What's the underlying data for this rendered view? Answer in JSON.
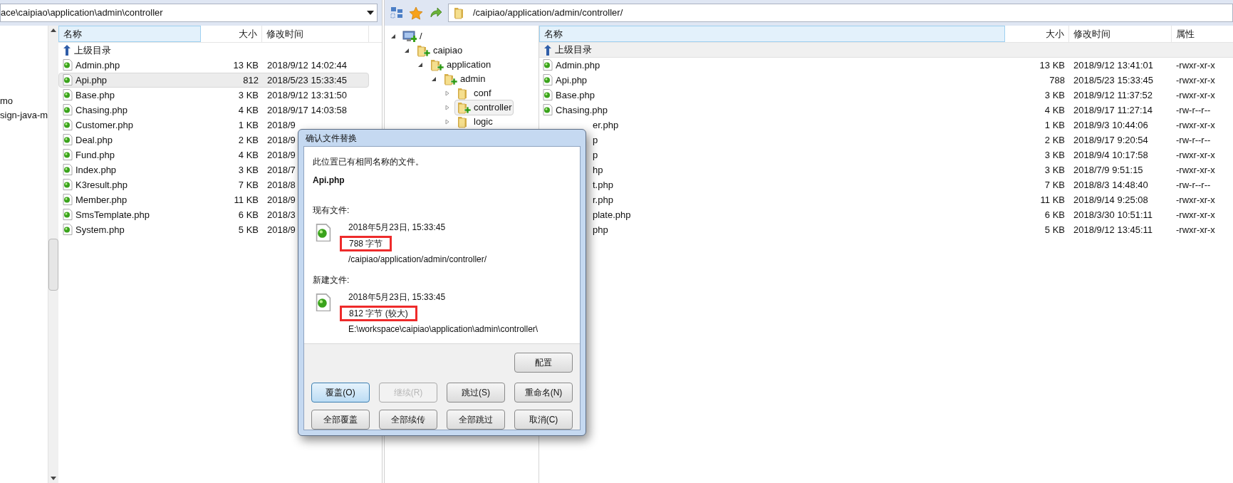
{
  "local_panel": {
    "path": "ace\\caipiao\\application\\admin\\controller",
    "tree_items": [
      {
        "label": "mo"
      },
      {
        "label": "sign-java-m"
      }
    ],
    "columns": [
      "名称",
      "大小",
      "修改时间"
    ],
    "parent_row": "上级目录",
    "files": [
      {
        "name": "Admin.php",
        "size": "13 KB",
        "modified": "2018/9/12 14:02:44",
        "selected": false
      },
      {
        "name": "Api.php",
        "size": "812",
        "modified": "2018/5/23 15:33:45",
        "selected": true
      },
      {
        "name": "Base.php",
        "size": "3 KB",
        "modified": "2018/9/12 13:31:50",
        "selected": false
      },
      {
        "name": "Chasing.php",
        "size": "4 KB",
        "modified": "2018/9/17 14:03:58",
        "selected": false
      },
      {
        "name": "Customer.php",
        "size": "1 KB",
        "modified": "2018/9",
        "selected": false
      },
      {
        "name": "Deal.php",
        "size": "2 KB",
        "modified": "2018/9",
        "selected": false
      },
      {
        "name": "Fund.php",
        "size": "4 KB",
        "modified": "2018/9",
        "selected": false
      },
      {
        "name": "Index.php",
        "size": "3 KB",
        "modified": "2018/7",
        "selected": false
      },
      {
        "name": "K3result.php",
        "size": "7 KB",
        "modified": "2018/8",
        "selected": false
      },
      {
        "name": "Member.php",
        "size": "11 KB",
        "modified": "2018/9",
        "selected": false
      },
      {
        "name": "SmsTemplate.php",
        "size": "6 KB",
        "modified": "2018/3",
        "selected": false
      },
      {
        "name": "System.php",
        "size": "5 KB",
        "modified": "2018/9",
        "selected": false
      }
    ]
  },
  "remote_panel": {
    "path": "/caipiao/application/admin/controller/",
    "tree": [
      {
        "label": "/",
        "kind": "computer",
        "expanded": true,
        "selected": false,
        "children": [
          {
            "label": "caipiao",
            "kind": "folder-plus",
            "expanded": true,
            "selected": false,
            "children": [
              {
                "label": "application",
                "kind": "folder-plus",
                "expanded": true,
                "selected": false,
                "children": [
                  {
                    "label": "admin",
                    "kind": "folder-plus",
                    "expanded": true,
                    "selected": false,
                    "children": [
                      {
                        "label": "conf",
                        "kind": "folder",
                        "expanded": false,
                        "selected": false
                      },
                      {
                        "label": "controller",
                        "kind": "folder-plus",
                        "expanded": false,
                        "selected": true
                      },
                      {
                        "label": "logic",
                        "kind": "folder",
                        "expanded": false,
                        "selected": false
                      }
                    ]
                  }
                ]
              }
            ]
          }
        ]
      }
    ],
    "columns": [
      "名称",
      "大小",
      "修改时间",
      "属性"
    ],
    "parent_row": "上级目录",
    "files": [
      {
        "name": "Admin.php",
        "cut": false,
        "size": "13 KB",
        "modified": "2018/9/12 13:41:01",
        "rights": "-rwxr-xr-x"
      },
      {
        "name": "Api.php",
        "cut": false,
        "size": "788",
        "modified": "2018/5/23 15:33:45",
        "rights": "-rwxr-xr-x"
      },
      {
        "name": "Base.php",
        "cut": false,
        "size": "3 KB",
        "modified": "2018/9/12 11:37:52",
        "rights": "-rwxr-xr-x"
      },
      {
        "name": "Chasing.php",
        "cut": false,
        "size": "4 KB",
        "modified": "2018/9/17 11:27:14",
        "rights": "-rw-r--r--"
      },
      {
        "name": "er.php",
        "cut": true,
        "size": "1 KB",
        "modified": "2018/9/3 10:44:06",
        "rights": "-rwxr-xr-x"
      },
      {
        "name": "p",
        "cut": true,
        "size": "2 KB",
        "modified": "2018/9/17 9:20:54",
        "rights": "-rw-r--r--"
      },
      {
        "name": "p",
        "cut": true,
        "size": "3 KB",
        "modified": "2018/9/4 10:17:58",
        "rights": "-rwxr-xr-x"
      },
      {
        "name": "hp",
        "cut": true,
        "size": "3 KB",
        "modified": "2018/7/9 9:51:15",
        "rights": "-rwxr-xr-x"
      },
      {
        "name": "t.php",
        "cut": true,
        "size": "7 KB",
        "modified": "2018/8/3 14:48:40",
        "rights": "-rw-r--r--"
      },
      {
        "name": "r.php",
        "cut": true,
        "size": "11 KB",
        "modified": "2018/9/14 9:25:08",
        "rights": "-rwxr-xr-x"
      },
      {
        "name": "plate.php",
        "cut": true,
        "size": "6 KB",
        "modified": "2018/3/30 10:51:11",
        "rights": "-rwxr-xr-x"
      },
      {
        "name": "php",
        "cut": true,
        "size": "5 KB",
        "modified": "2018/9/12 13:45:11",
        "rights": "-rwxr-xr-x"
      }
    ]
  },
  "dialog": {
    "title": "确认文件替换",
    "message": "此位置已有相同名称的文件。",
    "file_name": "Api.php",
    "versions": [
      {
        "heading": "现有文件:",
        "date": "2018年5月23日, 15:33:45",
        "size": "788 字节",
        "location": "/caipiao/application/admin/controller/",
        "highlighted": true
      },
      {
        "heading": "新建文件:",
        "date": "2018年5月23日, 15:33:45",
        "size": "812 字节 (较大)",
        "location": "E:\\workspace\\caipiao\\application\\admin\\controller\\",
        "highlighted": true
      }
    ],
    "options_button": "配置",
    "buttons": [
      {
        "label": "覆盖(O)",
        "default": true,
        "disabled": false
      },
      {
        "label": "继续(R)",
        "default": false,
        "disabled": true
      },
      {
        "label": "跳过(S)",
        "default": false,
        "disabled": false
      },
      {
        "label": "重命名(N)",
        "default": false,
        "disabled": false
      },
      {
        "label": "全部覆盖",
        "default": false,
        "disabled": false
      },
      {
        "label": "全部续传",
        "default": false,
        "disabled": false
      },
      {
        "label": "全部跳过",
        "default": false,
        "disabled": false
      },
      {
        "label": "取消(C)",
        "default": false,
        "disabled": false
      }
    ]
  }
}
